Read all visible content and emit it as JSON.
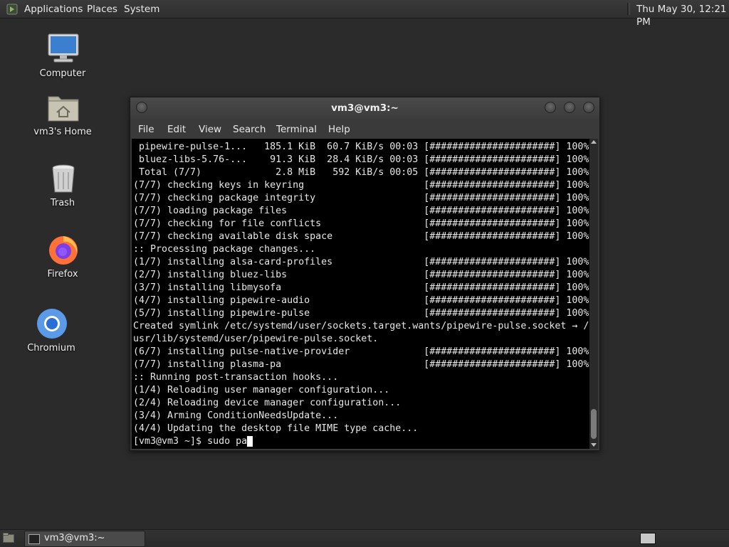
{
  "top_panel": {
    "menus": [
      "Applications",
      "Places",
      "System"
    ],
    "clock": "Thu May 30, 12:21 PM"
  },
  "desktop": {
    "icons": [
      {
        "label": "Computer",
        "icon": "computer-icon"
      },
      {
        "label": "vm3's Home",
        "icon": "home-folder-icon"
      },
      {
        "label": "Trash",
        "icon": "trash-icon"
      },
      {
        "label": "Firefox",
        "icon": "firefox-icon"
      },
      {
        "label": "Chromium",
        "icon": "chromium-icon"
      }
    ]
  },
  "terminal": {
    "title": "vm3@vm3:~",
    "menu": [
      "File",
      "Edit",
      "View",
      "Search",
      "Terminal",
      "Help"
    ],
    "lines": [
      " pipewire-pulse-1...   185.1 KiB  60.7 KiB/s 00:03 [######################] 100%",
      " bluez-libs-5.76-...    91.3 KiB  28.4 KiB/s 00:03 [######################] 100%",
      " Total (7/7)             2.8 MiB   592 KiB/s 00:05 [######################] 100%",
      "(7/7) checking keys in keyring                     [######################] 100%",
      "(7/7) checking package integrity                   [######################] 100%",
      "(7/7) loading package files                        [######################] 100%",
      "(7/7) checking for file conflicts                  [######################] 100%",
      "(7/7) checking available disk space                [######################] 100%",
      ":: Processing package changes...",
      "(1/7) installing alsa-card-profiles                [######################] 100%",
      "(2/7) installing bluez-libs                        [######################] 100%",
      "(3/7) installing libmysofa                         [######################] 100%",
      "(4/7) installing pipewire-audio                    [######################] 100%",
      "(5/7) installing pipewire-pulse                    [######################] 100%",
      "Created symlink /etc/systemd/user/sockets.target.wants/pipewire-pulse.socket → /",
      "usr/lib/systemd/user/pipewire-pulse.socket.",
      "(6/7) installing pulse-native-provider             [######################] 100%",
      "(7/7) installing plasma-pa                         [######################] 100%",
      ":: Running post-transaction hooks...",
      "(1/4) Reloading user manager configuration...",
      "(2/4) Reloading device manager configuration...",
      "(3/4) Arming ConditionNeedsUpdate...",
      "(4/4) Updating the desktop file MIME type cache..."
    ],
    "prompt": "[vm3@vm3 ~]$ sudo pa"
  },
  "taskbar": {
    "task_label": "vm3@vm3:~"
  }
}
